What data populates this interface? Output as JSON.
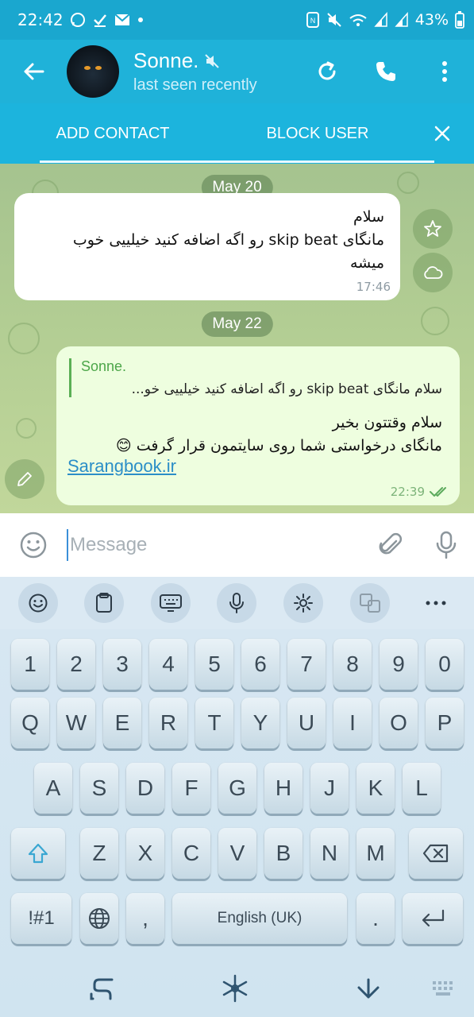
{
  "status_bar": {
    "time": "22:42",
    "battery": "43%",
    "left_icons": [
      "whatsapp-icon",
      "check-icon",
      "mail-icon",
      "dot-icon"
    ],
    "right_icons": [
      "nfc-icon",
      "mute-icon",
      "wifi-icon",
      "signal-icon",
      "signal-icon",
      "battery-icon"
    ]
  },
  "header": {
    "name": "Sonne.",
    "subtitle": "last seen recently",
    "muted": true
  },
  "action_bar": {
    "add_contact": "ADD CONTACT",
    "block_user": "BLOCK USER"
  },
  "chat": {
    "messages": [
      {
        "date": "May 20",
        "direction": "in",
        "lines": [
          "سلام",
          "مانگای skip beat رو اگه اضافه کنید خیلییی خوب",
          "میشه"
        ],
        "time": "17:46"
      },
      {
        "date": "May 22",
        "direction": "out",
        "reply_name": "Sonne.",
        "reply_text": "سلام مانگای skip beat رو اگه اضافه کنید خیلییی خو...",
        "lines": [
          "سلام وقتتون بخیر",
          "مانگای درخواستی شما روی سایتمون قرار گرفت 😊"
        ],
        "link": "Sarangbook.ir",
        "time": "22:39",
        "status": "read"
      }
    ]
  },
  "composer": {
    "placeholder": "Message"
  },
  "keyboard": {
    "row1": [
      "1",
      "2",
      "3",
      "4",
      "5",
      "6",
      "7",
      "8",
      "9",
      "0"
    ],
    "row2": [
      "Q",
      "W",
      "E",
      "R",
      "T",
      "Y",
      "U",
      "I",
      "O",
      "P"
    ],
    "row3": [
      "A",
      "S",
      "D",
      "F",
      "G",
      "H",
      "J",
      "K",
      "L"
    ],
    "row4": [
      "Z",
      "X",
      "C",
      "V",
      "B",
      "N",
      "M"
    ],
    "sym": "!#1",
    "comma": ",",
    "space": "English (UK)",
    "period": "."
  },
  "colors": {
    "header": "#1fb2d9",
    "accent": "#1aa7cf",
    "out_bubble": "#eefedf",
    "link": "#2b8ec7"
  }
}
